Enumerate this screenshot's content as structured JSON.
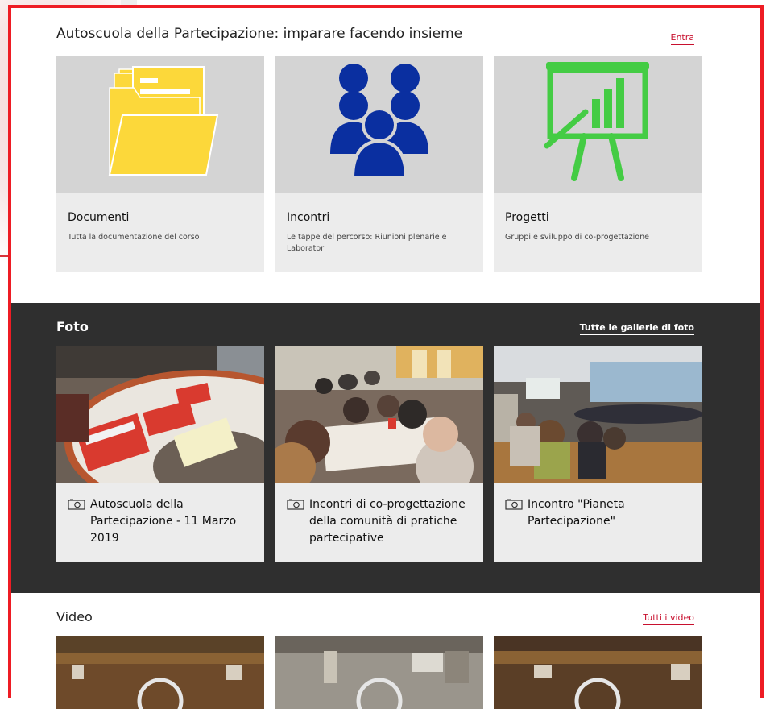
{
  "documents_section": {
    "title": "Autoscuola della Partecipazione: imparare facendo insieme",
    "link": "Entra",
    "cards": [
      {
        "title": "Documenti",
        "description": "Tutta la documentazione del corso",
        "icon": "folder-icon",
        "icon_color": "#fcd83a"
      },
      {
        "title": "Incontri",
        "description": "Le tappe del percorso: Riunioni plenarie e Laboratori",
        "icon": "people-icon",
        "icon_color": "#0a2fa0"
      },
      {
        "title": "Progetti",
        "description": "Gruppi e sviluppo di co-progettazione",
        "icon": "presentation-chart-icon",
        "icon_color": "#44cc44"
      }
    ]
  },
  "photo_section": {
    "title": "Foto",
    "link": "Tutte le gallerie di foto",
    "galleries": [
      {
        "title": "Autoscuola della Partecipazione - 11 Marzo 2019",
        "icon": "camera-icon"
      },
      {
        "title": "Incontri di co-progettazione della comunità di pratiche partecipative",
        "icon": "camera-icon"
      },
      {
        "title": "Incontro \"Pianeta Partecipazione\"",
        "icon": "camera-icon"
      }
    ]
  },
  "video_section": {
    "title": "Video",
    "link": "Tutti i video"
  },
  "colors": {
    "accent": "#c8102e",
    "frame": "#ee1c24",
    "dark_band": "#2f2f2f",
    "card_bg": "#ececec"
  }
}
